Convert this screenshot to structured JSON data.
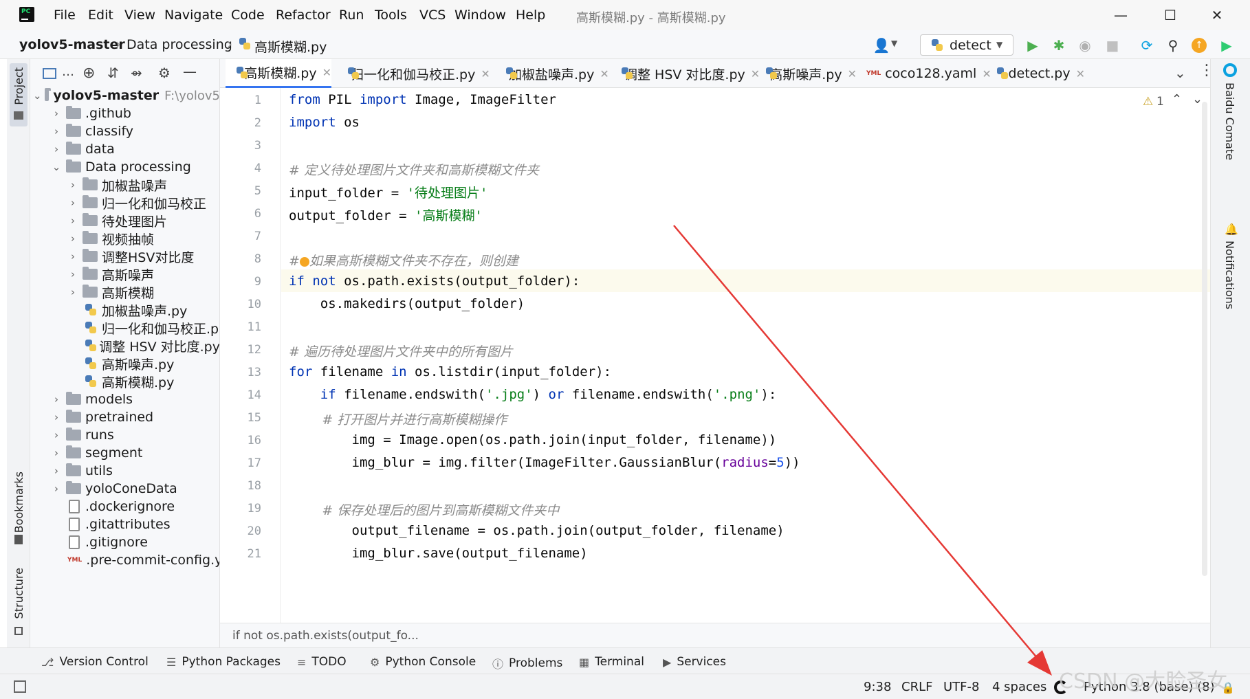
{
  "menu": {
    "file": "File",
    "edit": "Edit",
    "view": "View",
    "navigate": "Navigate",
    "code": "Code",
    "refactor": "Refactor",
    "run": "Run",
    "tools": "Tools",
    "vcs": "VCS",
    "window": "Window",
    "help": "Help"
  },
  "window_title": "高斯模糊.py - 高斯模糊.py",
  "breadcrumb": {
    "project": "yolov5-master",
    "folder": "Data processing",
    "file": "高斯模糊.py"
  },
  "run_config": "detect",
  "tool_stripe": {
    "project": "Project",
    "bookmarks": "Bookmarks",
    "structure": "Structure",
    "baidu": "Baidu Comate",
    "notifications": "Notifications"
  },
  "tree": {
    "root": "yolov5-master",
    "root_path": "F:\\yolov5",
    "items": [
      {
        "label": ".github"
      },
      {
        "label": "classify"
      },
      {
        "label": "data"
      },
      {
        "label": "Data processing"
      },
      {
        "label": "加椒盐噪声"
      },
      {
        "label": "归一化和伽马校正"
      },
      {
        "label": "待处理图片"
      },
      {
        "label": "视频抽帧"
      },
      {
        "label": "调整HSV对比度"
      },
      {
        "label": "高斯噪声"
      },
      {
        "label": "高斯模糊"
      },
      {
        "label": "加椒盐噪声.py"
      },
      {
        "label": "归一化和伽马校正.p"
      },
      {
        "label": "调整 HSV 对比度.py"
      },
      {
        "label": "高斯噪声.py"
      },
      {
        "label": "高斯模糊.py"
      },
      {
        "label": "models"
      },
      {
        "label": "pretrained"
      },
      {
        "label": "runs"
      },
      {
        "label": "segment"
      },
      {
        "label": "utils"
      },
      {
        "label": "yoloConeData"
      },
      {
        "label": ".dockerignore"
      },
      {
        "label": ".gitattributes"
      },
      {
        "label": ".gitignore"
      },
      {
        "label": ".pre-commit-config.y"
      }
    ]
  },
  "tabs": [
    {
      "label": "高斯模糊.py"
    },
    {
      "label": "归一化和伽马校正.py"
    },
    {
      "label": "加椒盐噪声.py"
    },
    {
      "label": "调整 HSV 对比度.py"
    },
    {
      "label": "高斯噪声.py"
    },
    {
      "label": "coco128.yaml"
    },
    {
      "label": "detect.py"
    }
  ],
  "editor": {
    "warnings": "1",
    "line_numbers": [
      "1",
      "2",
      "3",
      "4",
      "5",
      "6",
      "7",
      "8",
      "9",
      "10",
      "11",
      "12",
      "13",
      "14",
      "15",
      "16",
      "17",
      "18",
      "19",
      "20",
      "21"
    ],
    "code": {
      "l1_a": "from",
      "l1_b": " PIL ",
      "l1_c": "import",
      "l1_d": " Image, ImageFilter",
      "l2_a": "import",
      "l2_b": " os",
      "l4": "# 定义待处理图片文件夹和高斯模糊文件夹",
      "l5_a": "input_folder = ",
      "l5_b": "'待处理图片'",
      "l6_a": "output_folder = ",
      "l6_b": "'高斯模糊'",
      "l8_a": "#",
      "l8_b": "如果高斯模糊文件夹不存在，则创建",
      "l9_a": "if",
      "l9_b": " ",
      "l9_c": "not",
      "l9_d": " os.path.exists(output_folder):",
      "l10": "    os.makedirs(output_folder)",
      "l12": "# 遍历待处理图片文件夹中的所有图片",
      "l13_a": "for",
      "l13_b": " filename ",
      "l13_c": "in",
      "l13_d": " os.listdir(input_folder):",
      "l14_a": "    ",
      "l14_b": "if",
      "l14_c": " filename.endswith(",
      "l14_d": "'.jpg'",
      "l14_e": ") ",
      "l14_f": "or",
      "l14_g": " filename.endswith(",
      "l14_h": "'.png'",
      "l14_i": "):",
      "l15": "        # 打开图片并进行高斯模糊操作",
      "l16": "        img = Image.open(os.path.join(input_folder, filename))",
      "l17_a": "        img_blur = img.filter(ImageFilter.GaussianBlur(",
      "l17_b": "radius",
      "l17_c": "=",
      "l17_d": "5",
      "l17_e": "))",
      "l19": "        # 保存处理后的图片到高斯模糊文件夹中",
      "l20": "        output_filename = os.path.join(output_folder, filename)",
      "l21": "        img_blur.save(output_filename)"
    },
    "breadcrumb": "if not os.path.exists(output_fo..."
  },
  "tool_windows": {
    "version_control": "Version Control",
    "python_packages": "Python Packages",
    "todo": "TODO",
    "python_console": "Python Console",
    "problems": "Problems",
    "terminal": "Terminal",
    "services": "Services"
  },
  "status": {
    "position": "9:38",
    "line_sep": "CRLF",
    "encoding": "UTF-8",
    "indent": "4 spaces",
    "interpreter": "Python 3.8 (base) (8)"
  },
  "watermark": "CSDN @大脸圣女",
  "colors": {
    "accent": "#3574f0",
    "run_green": "#4caf50",
    "arrow_red": "#e53935"
  }
}
